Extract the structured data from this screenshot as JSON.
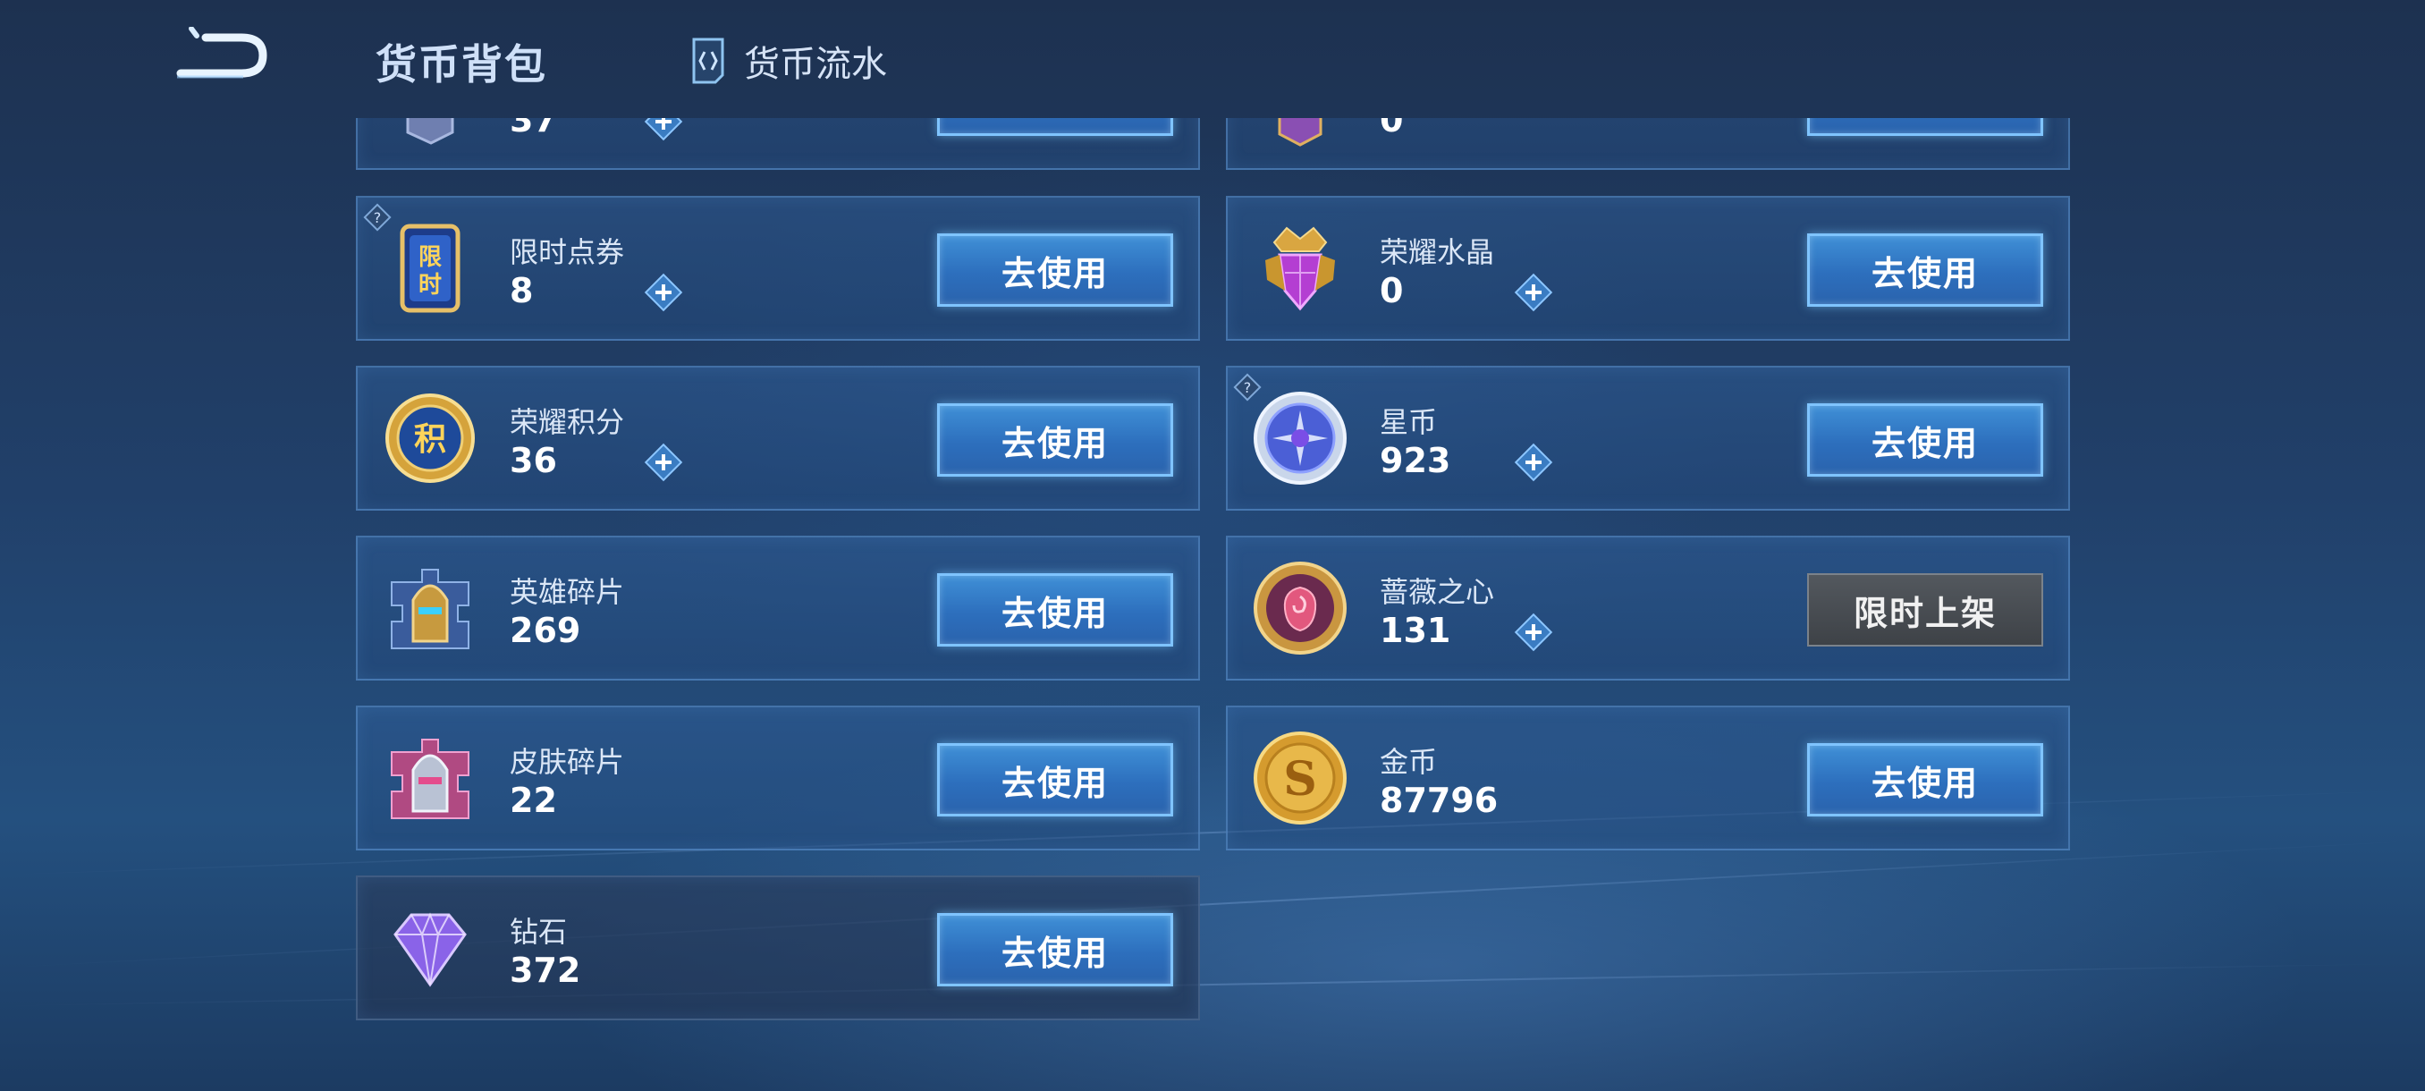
{
  "header": {
    "title": "货币背包",
    "flow_label": "货币流水"
  },
  "colors": {
    "accent": "#7fc4ff",
    "button_blue": "#2d6fbd",
    "button_gray": "#4a4e54",
    "card_border": "#5f96d2"
  },
  "partial_top": {
    "left": {
      "amount": "37",
      "icon": "coupon-card-icon"
    },
    "right": {
      "amount": "0",
      "icon": "purple-crest-icon"
    }
  },
  "items": [
    {
      "name": "限时点券",
      "amount": "8",
      "button": "去使用",
      "icon": "limited-coupon-icon",
      "has_hint": true
    },
    {
      "name": "荣耀水晶",
      "amount": "0",
      "button": "去使用",
      "icon": "glory-crystal-icon",
      "has_hint": false
    },
    {
      "name": "荣耀积分",
      "amount": "36",
      "button": "去使用",
      "icon": "glory-points-icon",
      "has_hint": false
    },
    {
      "name": "星币",
      "amount": "923",
      "button": "去使用",
      "icon": "star-coin-icon",
      "has_hint": true
    },
    {
      "name": "英雄碎片",
      "amount": "269",
      "button": "去使用",
      "icon": "hero-fragment-icon",
      "has_hint": false
    },
    {
      "name": "蔷薇之心",
      "amount": "131",
      "button": "限时上架",
      "icon": "rose-heart-icon",
      "has_hint": false
    },
    {
      "name": "皮肤碎片",
      "amount": "22",
      "button": "去使用",
      "icon": "skin-fragment-icon",
      "has_hint": false
    },
    {
      "name": "金币",
      "amount": "87796",
      "button": "去使用",
      "icon": "gold-coin-icon",
      "has_hint": false
    },
    {
      "name": "钻石",
      "amount": "372",
      "button": "去使用",
      "icon": "diamond-icon",
      "has_hint": false
    }
  ]
}
